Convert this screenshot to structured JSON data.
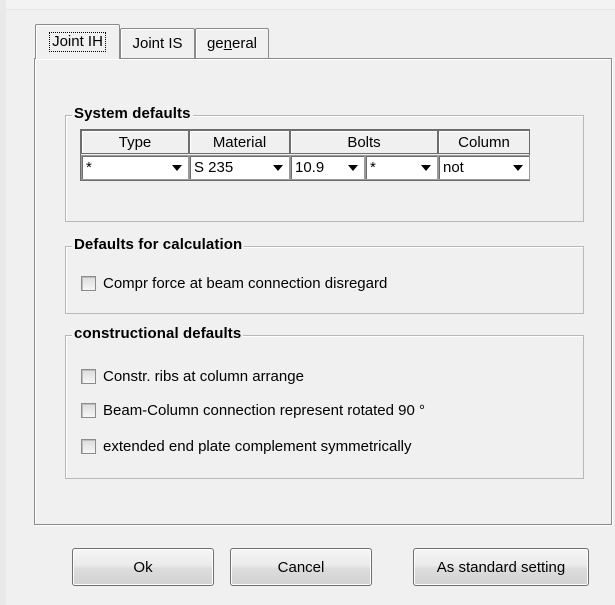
{
  "tabs": [
    {
      "label": "Joint IH",
      "active": true
    },
    {
      "label": "Joint IS",
      "active": false
    },
    {
      "label_pre": "ge",
      "label_underlined": "n",
      "label_post": "eral",
      "active": false
    }
  ],
  "system_defaults": {
    "title": "System defaults",
    "headers": {
      "type": "Type",
      "material": "Material",
      "bolts": "Bolts",
      "column": "Column"
    },
    "values": {
      "type": "*",
      "material": "S 235",
      "bolt_grade": "10.9",
      "bolt_size": "*",
      "column": "not"
    }
  },
  "calculation": {
    "title": "Defaults for calculation",
    "options": [
      {
        "label": "Compr force at beam connection disregard",
        "checked": false
      }
    ]
  },
  "constructional": {
    "title": "constructional defaults",
    "options": [
      {
        "label": "Constr. ribs at column arrange",
        "checked": false
      },
      {
        "label": "Beam-Column connection represent rotated 90 °",
        "checked": false
      },
      {
        "label": "extended end plate complement symmetrically",
        "checked": false
      }
    ]
  },
  "buttons": {
    "ok": "Ok",
    "cancel": "Cancel",
    "standard": "As standard setting"
  }
}
